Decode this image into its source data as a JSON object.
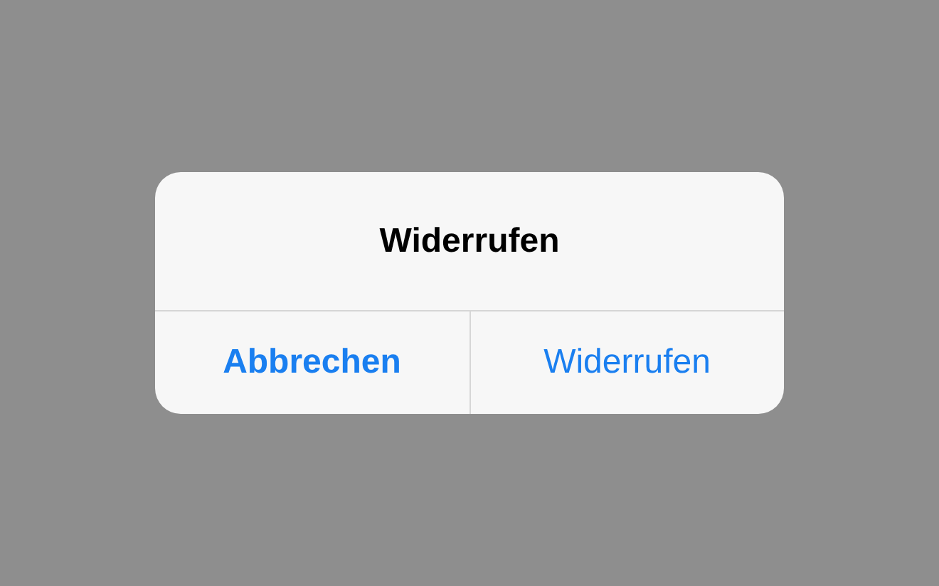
{
  "alert": {
    "title": "Widerrufen",
    "buttons": [
      {
        "label": "Abbrechen",
        "kind": "cancel"
      },
      {
        "label": "Widerrufen",
        "kind": "default"
      }
    ]
  }
}
